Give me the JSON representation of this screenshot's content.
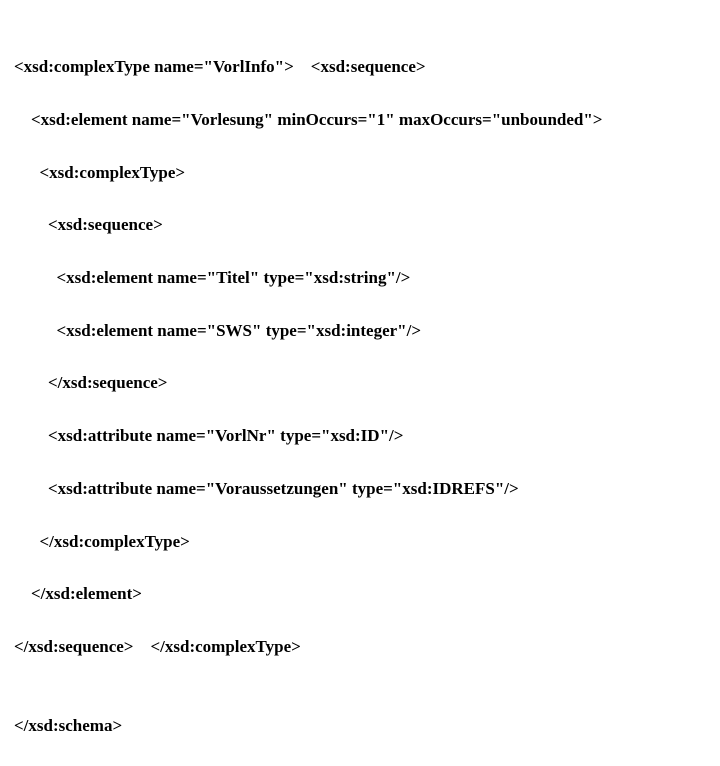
{
  "lines": {
    "l1": "<xsd:complexType name=\"VorlInfo\">    <xsd:sequence>",
    "l2": "    <xsd:element name=\"Vorlesung\" minOccurs=\"1\" maxOccurs=\"unbounded\">",
    "l3": "      <xsd:complexType>",
    "l4": "        <xsd:sequence>",
    "l5": "          <xsd:element name=\"Titel\" type=\"xsd:string\"/>",
    "l6": "          <xsd:element name=\"SWS\" type=\"xsd:integer\"/>",
    "l7": "        </xsd:sequence>",
    "l8": "        <xsd:attribute name=\"VorlNr\" type=\"xsd:ID\"/>",
    "l9": "        <xsd:attribute name=\"Voraussetzungen\" type=\"xsd:IDREFS\"/>",
    "l10": "      </xsd:complexType>",
    "l11": "    </xsd:element>",
    "l12": "</xsd:sequence>    </xsd:complexType>",
    "blank": "",
    "l13": "</xsd:schema>"
  }
}
